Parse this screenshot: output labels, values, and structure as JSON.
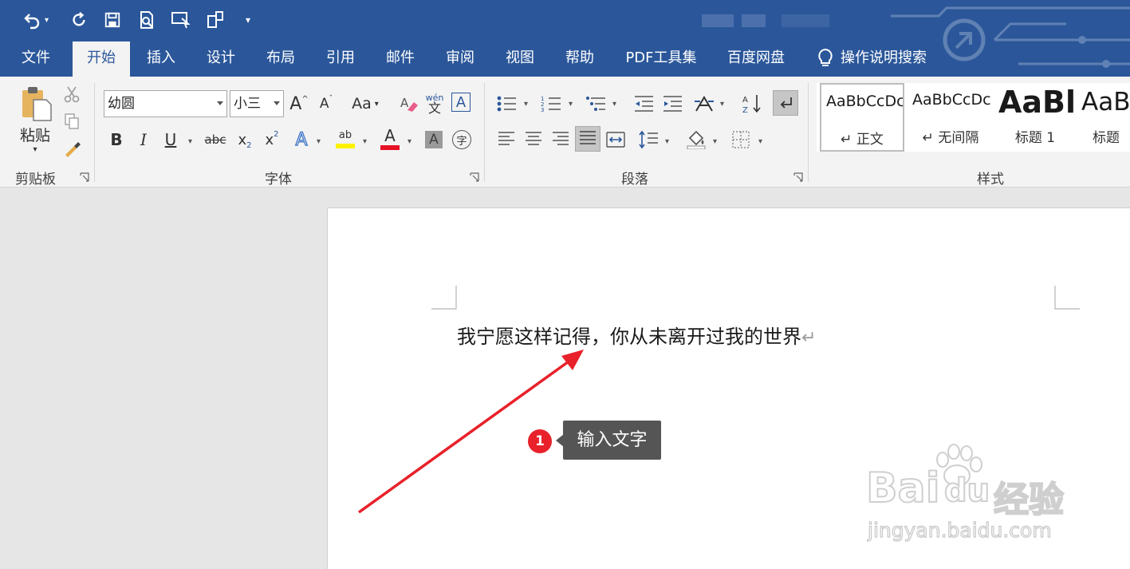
{
  "quick_access": {
    "undo_icon": "undo-icon",
    "redo_icon": "redo-icon",
    "save_icon": "save-icon",
    "print_preview_icon": "print-preview-icon",
    "touch_mode_icon": "touch-mode-icon",
    "customize_icon": "customize-qat-icon"
  },
  "tabs": [
    {
      "label": "文件"
    },
    {
      "label": "开始"
    },
    {
      "label": "插入"
    },
    {
      "label": "设计"
    },
    {
      "label": "布局"
    },
    {
      "label": "引用"
    },
    {
      "label": "邮件"
    },
    {
      "label": "审阅"
    },
    {
      "label": "视图"
    },
    {
      "label": "帮助"
    },
    {
      "label": "PDF工具集"
    },
    {
      "label": "百度网盘"
    },
    {
      "label": "操作说明搜索"
    }
  ],
  "clipboard": {
    "paste_label": "粘贴",
    "group_label": "剪贴板"
  },
  "font": {
    "name": "幼圆",
    "size": "小三",
    "grow_label": "A",
    "shrink_label": "A",
    "case_label": "Aa",
    "phonetic_top": "wén",
    "phonetic_bottom": "文",
    "border_char": "A",
    "bold": "B",
    "italic": "I",
    "underline": "U",
    "strike": "abc",
    "subscript": "x",
    "sub_mark": "2",
    "superscript": "x",
    "sup_mark": "2",
    "effects": "A",
    "highlight_top": "ab",
    "color_char": "A",
    "shading_char": "A",
    "enclose_char": "字",
    "group_label": "字体",
    "highlight_color": "#fff200",
    "font_color": "#e81123"
  },
  "paragraph": {
    "group_label": "段落"
  },
  "styles": {
    "items": [
      {
        "preview": "AaBbCcDc",
        "name": "↵ 正文"
      },
      {
        "preview": "AaBbCcDc",
        "name": "↵ 无间隔"
      },
      {
        "preview": "AaBl",
        "name": "标题 1"
      },
      {
        "preview": "AaB",
        "name": "标题"
      }
    ],
    "group_label": "样式"
  },
  "document": {
    "text": "我宁愿这样记得，你从未离开过我的世界",
    "paragraph_mark": "↵"
  },
  "annotation": {
    "step": "1",
    "text": "输入文字",
    "arrow_color": "#e8212a"
  },
  "watermark": {
    "brand": "Bai",
    "brand2": "du",
    "brand_cn": "经验",
    "url": "jingyan.baidu.com"
  },
  "colors": {
    "accent": "#2b579a",
    "ribbon": "#f3f3f3"
  }
}
